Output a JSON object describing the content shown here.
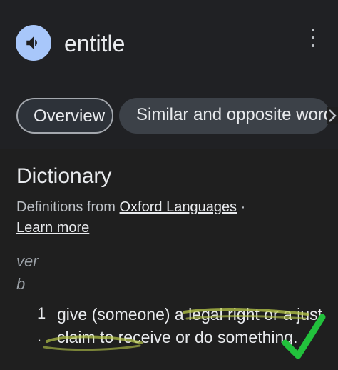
{
  "entry": {
    "word": "entitle",
    "speaker_icon": "volume-up-icon",
    "more_icon": "more-vertical-icon"
  },
  "tabs": [
    {
      "label": "Overview",
      "selected": true
    },
    {
      "label": "Similar and opposite words",
      "selected": false
    }
  ],
  "dictionary": {
    "title": "Dictionary",
    "source_prefix": "Definitions from",
    "source_link": "Oxford Languages",
    "separator": "·",
    "learn_more": "Learn more",
    "part_of_speech": "verb",
    "senses": [
      {
        "number": "1",
        "marker": ".",
        "definition": "give (someone) a legal right or a just claim to receive or do something."
      }
    ]
  },
  "annotations": {
    "highlight_color": "#b8c84a",
    "checkmark_color": "#22c13c",
    "checkmark_icon": "checkmark-icon"
  }
}
